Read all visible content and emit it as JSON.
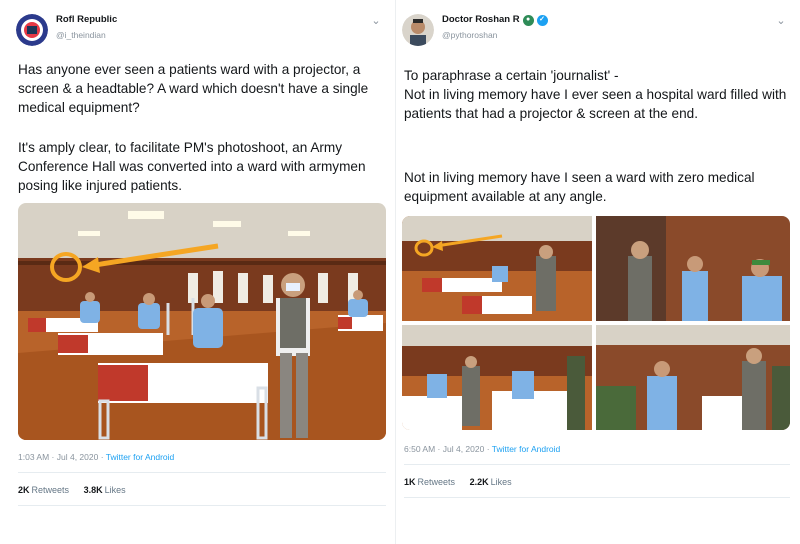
{
  "left_tweet": {
    "display_name": "Rofl Republic",
    "handle": "@i_theindian",
    "paragraph1": "Has anyone ever seen a patients ward with a projector, a screen & a headtable? A ward which doesn't have a single medical equipment?",
    "paragraph2": "It's amply clear, to facilitate PM's photoshoot, an Army Conference Hall was converted into a ward with armymen posing like injured patients.",
    "timestamp": "1:03 AM · Jul 4, 2020 · ",
    "source": "Twitter for Android",
    "retweets": "2K",
    "retweets_label": "Retweets",
    "likes": "3.8K",
    "likes_label": "Likes"
  },
  "right_tweet": {
    "display_name": "Doctor Roshan R",
    "handle": "@pythoroshan",
    "paragraph1": "To paraphrase a certain 'journalist' -\nNot in living memory have I ever seen a hospital ward filled with patients that had a projector & screen at the end.",
    "paragraph2": "Not in living memory have I seen a ward with zero medical equipment available at any angle.",
    "timestamp": "6:50 AM · Jul 4, 2020 · ",
    "source": "Twitter for Android",
    "retweets": "1K",
    "retweets_label": "Retweets",
    "likes": "2.2K",
    "likes_label": "Likes"
  },
  "colors": {
    "accent": "#1da1f2",
    "arrow": "#f5a623",
    "bedsheet_red": "#c0392b",
    "floor": "#b8632a"
  },
  "icons": [
    "chevron-down-icon",
    "globe-icon",
    "verified-icon"
  ]
}
